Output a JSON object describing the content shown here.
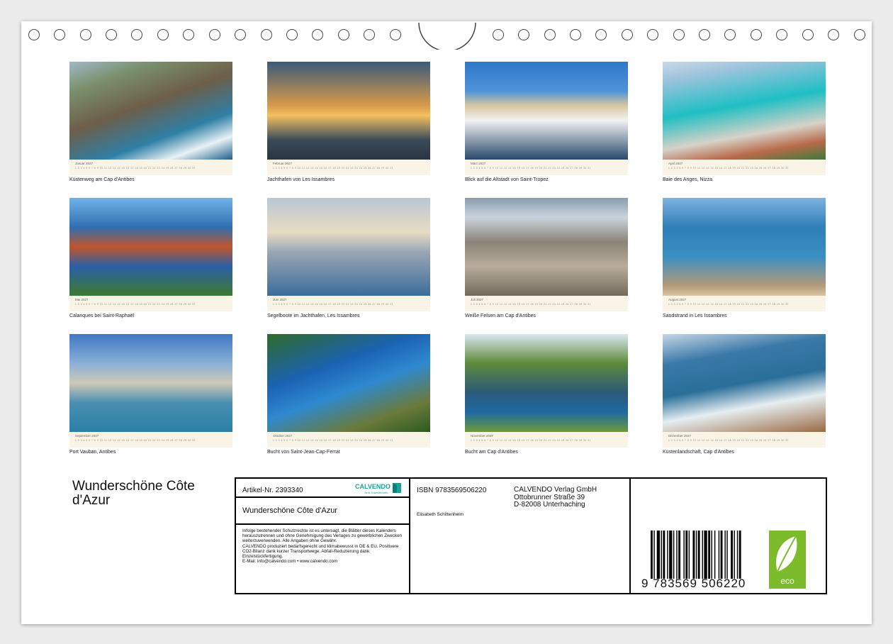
{
  "calendar": {
    "title": "Wunderschöne Côte d'Azur",
    "year": "2027",
    "days_row": "1 2 3 4 5 6 7 8 9 10 11 12 13 14 15 16 17 18 19 20 21 22 23 24 25 26 27 28 29 30 31",
    "months": [
      {
        "month": "Januar",
        "caption": "Küstenweg am Cap d'Antibes"
      },
      {
        "month": "Februar",
        "caption": "Jachthafen von Les Issambres"
      },
      {
        "month": "März",
        "caption": "Blick auf die Altstadt von Saint-Tropez"
      },
      {
        "month": "April",
        "caption": "Baie des Anges, Nizza"
      },
      {
        "month": "Mai",
        "caption": "Calanques bei Saint-Raphaël"
      },
      {
        "month": "Juni",
        "caption": "Segelboote im Jachthafen, Les Issambres"
      },
      {
        "month": "Juli",
        "caption": "Weiße Felsen am Cap d'Antibes"
      },
      {
        "month": "August",
        "caption": "Sandstrand in Les Issambres"
      },
      {
        "month": "September",
        "caption": "Port Vauban, Antibes"
      },
      {
        "month": "Oktober",
        "caption": "Bucht von Saint-Jean-Cap-Ferrat"
      },
      {
        "month": "November",
        "caption": "Bucht am Cap d'Antibes"
      },
      {
        "month": "Dezember",
        "caption": "Küstenlandschaft, Cap d'Antibes"
      }
    ]
  },
  "info": {
    "article": "Artikel-Nr. 2393340",
    "brand": "CALVENDO",
    "brand_tag": "Jede Kalenderidee",
    "product_title": "Wunderschöne Côte d'Azur",
    "legal": "Infolge bestehender Schutzrechte ist es untersagt, die Blätter dieses Kalenders herauszutrennen und ohne Genehmigung des Verlages zu gewerblichen Zwecken weiterzuverwenden. Alle Angaben ohne Gewähr.\nCALVENDO produziert bedarfsgerecht und klimabewusst in DE & EU. Positivere CO2-Bilanz dank kurzer Transportwege. Abfall-Reduzierung dank Einzelstückfertigung.\nE-Mail: info@calvendo.com • www.calvendo.com",
    "isbn": "ISBN 9783569506220",
    "author": "Elisabeth Schittenhelm",
    "publisher": "CALVENDO Verlag GmbH\nOttobrunner Straße 39\nD-82008 Unterhaching",
    "barcode_number": "9 783569 506220",
    "eco_label": "eco"
  },
  "colors": {
    "calendar_strip": "#faf4e6",
    "eco_green": "#7cbc2a",
    "calvendo_teal": "#17a39a"
  }
}
